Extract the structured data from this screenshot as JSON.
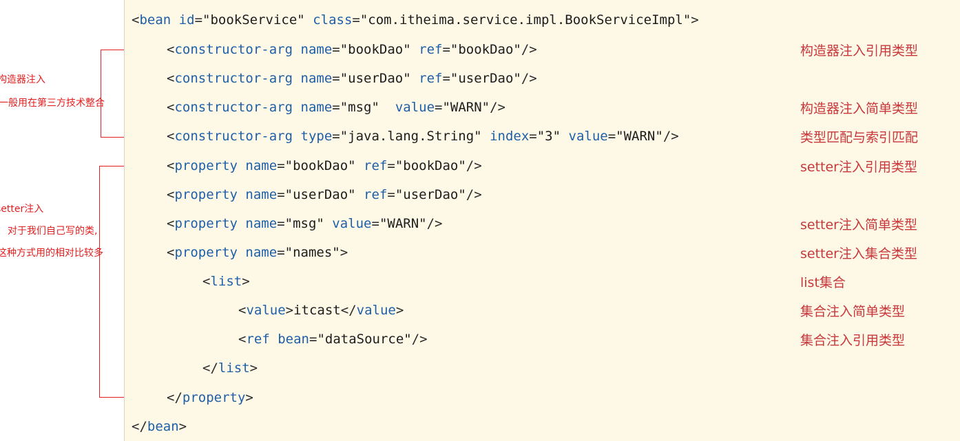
{
  "code": {
    "l1": {
      "open": "<",
      "tag": "bean",
      "a1": "id",
      "eq1": "=",
      "v1": "\"bookService\"",
      "a2": "class",
      "eq2": "=",
      "v2": "\"com.itheima.service.impl.BookServiceImpl\"",
      "close": ">"
    },
    "l2": {
      "open": "<",
      "tag": "constructor-arg",
      "a1": "name",
      "eq1": "=",
      "v1": "\"bookDao\"",
      "a2": "ref",
      "eq2": "=",
      "v2": "\"bookDao\"",
      "close": "/>"
    },
    "l3": {
      "open": "<",
      "tag": "constructor-arg",
      "a1": "name",
      "eq1": "=",
      "v1": "\"userDao\"",
      "a2": "ref",
      "eq2": "=",
      "v2": "\"userDao\"",
      "close": "/>"
    },
    "l4": {
      "open": "<",
      "tag": "constructor-arg",
      "a1": "name",
      "eq1": "=",
      "v1": "\"msg\"",
      "a2": "value",
      "eq2": "=",
      "v2": "\"WARN\"",
      "close": "/>"
    },
    "l5": {
      "open": "<",
      "tag": "constructor-arg",
      "a1": "type",
      "eq1": "=",
      "v1": "\"java.lang.String\"",
      "a2": "index",
      "eq2": "=",
      "v2": "\"3\"",
      "a3": "value",
      "eq3": "=",
      "v3": "\"WARN\"",
      "close": "/>"
    },
    "l6": {
      "open": "<",
      "tag": "property",
      "a1": "name",
      "eq1": "=",
      "v1": "\"bookDao\"",
      "a2": "ref",
      "eq2": "=",
      "v2": "\"bookDao\"",
      "close": "/>"
    },
    "l7": {
      "open": "<",
      "tag": "property",
      "a1": "name",
      "eq1": "=",
      "v1": "\"userDao\"",
      "a2": "ref",
      "eq2": "=",
      "v2": "\"userDao\"",
      "close": "/>"
    },
    "l8": {
      "open": "<",
      "tag": "property",
      "a1": "name",
      "eq1": "=",
      "v1": "\"msg\"",
      "a2": "value",
      "eq2": "=",
      "v2": "\"WARN\"",
      "close": "/>"
    },
    "l9": {
      "open": "<",
      "tag": "property",
      "a1": "name",
      "eq1": "=",
      "v1": "\"names\"",
      "close": ">"
    },
    "l10": {
      "open": "<",
      "tag": "list",
      "close": ">"
    },
    "l11": {
      "open": "<",
      "tag": "value",
      "close": ">",
      "text": "itcast",
      "open2": "</",
      "tag2": "value",
      "close2": ">"
    },
    "l12": {
      "open": "<",
      "tag": "ref",
      "a1": "bean",
      "eq1": "=",
      "v1": "\"dataSource\"",
      "close": "/>"
    },
    "l13": {
      "open": "</",
      "tag": "list",
      "close": ">"
    },
    "l14": {
      "open": "</",
      "tag": "property",
      "close": ">"
    },
    "l15": {
      "open": "</",
      "tag": "bean",
      "close": ">"
    }
  },
  "notes": {
    "n2": "构造器注入引用类型",
    "n4": "构造器注入简单类型",
    "n5": "类型匹配与索引匹配",
    "n6": "setter注入引用类型",
    "n8": "setter注入简单类型",
    "n9": "setter注入集合类型",
    "n10": "list集合",
    "n11": "集合注入简单类型",
    "n12": "集合注入引用类型"
  },
  "side": {
    "constructor_title": "构造器注入",
    "constructor_desc": "一般用在第三方技术整合",
    "setter_title": "setter注入",
    "setter_desc1": "对于我们自己写的类,",
    "setter_desc2": "这种方式用的相对比较多"
  },
  "colors": {
    "panel_bg": "#fdf9e6",
    "keyword": "#1f5fa8",
    "annotation": "#c8373b",
    "bracket": "#e02020"
  }
}
